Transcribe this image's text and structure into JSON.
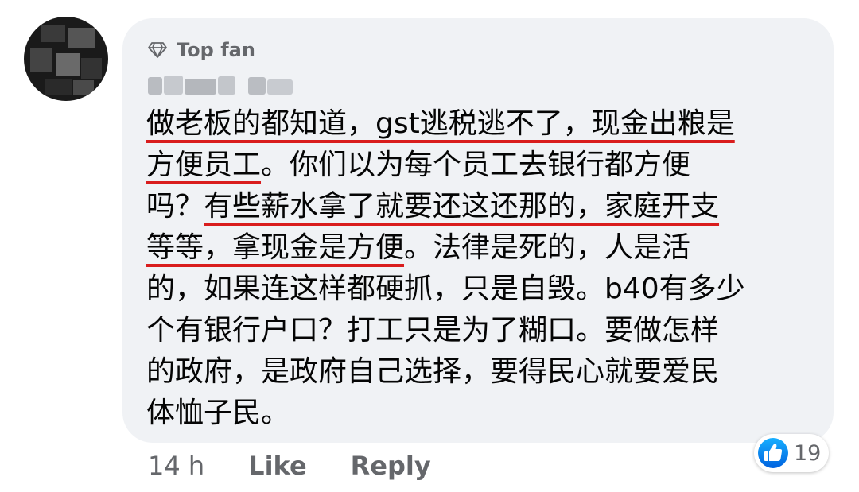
{
  "comment": {
    "badge": "Top fan",
    "badge_icon": "diamond-icon",
    "author_redacted": true,
    "lines": [
      [
        {
          "text": "做老板的都知道，gst逃税逃不了，现金出粮是",
          "hl": true
        }
      ],
      [
        {
          "text": "方便员工",
          "hl": true
        },
        {
          "text": "。你们以为每个员工去银行都方便",
          "hl": false
        }
      ],
      [
        {
          "text": "吗？",
          "hl": false
        },
        {
          "text": "有些薪水拿了就要还这还那的，家庭开支",
          "hl": true
        }
      ],
      [
        {
          "text": "等等，拿现金是方便",
          "hl": true
        },
        {
          "text": "。法律是死的，人是活",
          "hl": false
        }
      ],
      [
        {
          "text": "的，如果连这样都硬抓，只是自毁。b40有多少",
          "hl": false
        }
      ],
      [
        {
          "text": "个有银行户口？打工只是为了糊口。要做怎样",
          "hl": false
        }
      ],
      [
        {
          "text": "的政府，是政府自己选择，要得民心就要爱民",
          "hl": false
        }
      ],
      [
        {
          "text": "体恤子民。",
          "hl": false
        }
      ]
    ],
    "underline_color": "#d91d1d"
  },
  "actions": {
    "time": "14 h",
    "like": "Like",
    "reply": "Reply"
  },
  "reactions": {
    "icon": "like-thumb-icon",
    "count": "19",
    "color": "#1877f2"
  },
  "colors": {
    "bubble": "#f0f2f5",
    "text": "#050505",
    "secondary": "#65676b"
  }
}
